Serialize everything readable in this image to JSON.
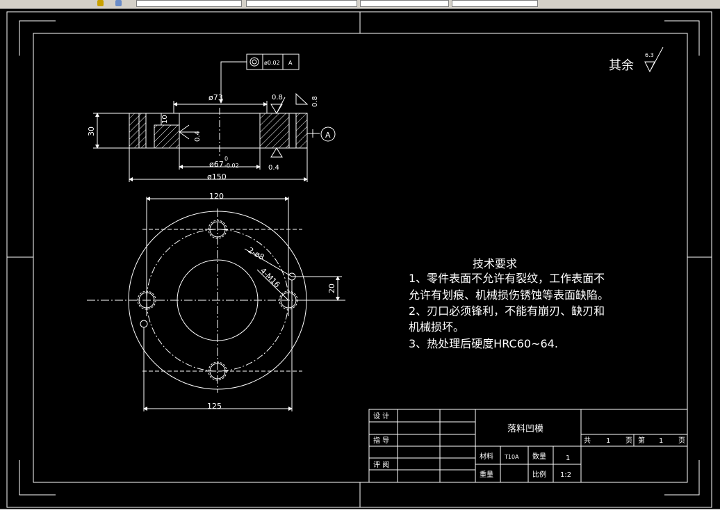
{
  "toolbar": {
    "fields": [
      "",
      "",
      "",
      "",
      ""
    ]
  },
  "status_text": "",
  "roughness_general": {
    "label": "其余",
    "value": "6.3"
  },
  "tolerance_frame": {
    "symbol": "◎",
    "value": "ø0.02",
    "datum": "A"
  },
  "datum_label": "A",
  "dimensions": {
    "d73": "ø73",
    "d67": "ø67",
    "d67_upper": "0",
    "d67_lower": "-0.02",
    "d150": "ø150",
    "h30": "30",
    "h10": "10",
    "r08a": "0.8",
    "r08b": "0.8",
    "r04a": "0.4",
    "r04b": "0.4",
    "w120": "120",
    "w125": "125",
    "h20": "20",
    "holes_a": "2-ø8",
    "holes_b": "4-M16"
  },
  "tech_requirements": {
    "title": "技术要求",
    "lines": [
      "1、零件表面不允许有裂纹，工作表面不",
      "允许有划痕、机械损伤锈蚀等表面缺陷。",
      "2、刃口必须锋利，不能有崩刃、缺刃和",
      "机械损坏。",
      "3、热处理后硬度HRC60~64."
    ]
  },
  "title_block": {
    "design": "设 计",
    "review": "指 导",
    "audit": "评 阅",
    "part_name": "落料凹模",
    "total": "共",
    "total_n": "1",
    "page_word": "页",
    "sheet": "第",
    "sheet_n": "1",
    "page_word2": "页",
    "material_label": "材料",
    "material": "T10A",
    "qty_label": "数量",
    "qty": "1",
    "weight_label": "重量",
    "scale_label": "比例",
    "scale": "1:2"
  }
}
